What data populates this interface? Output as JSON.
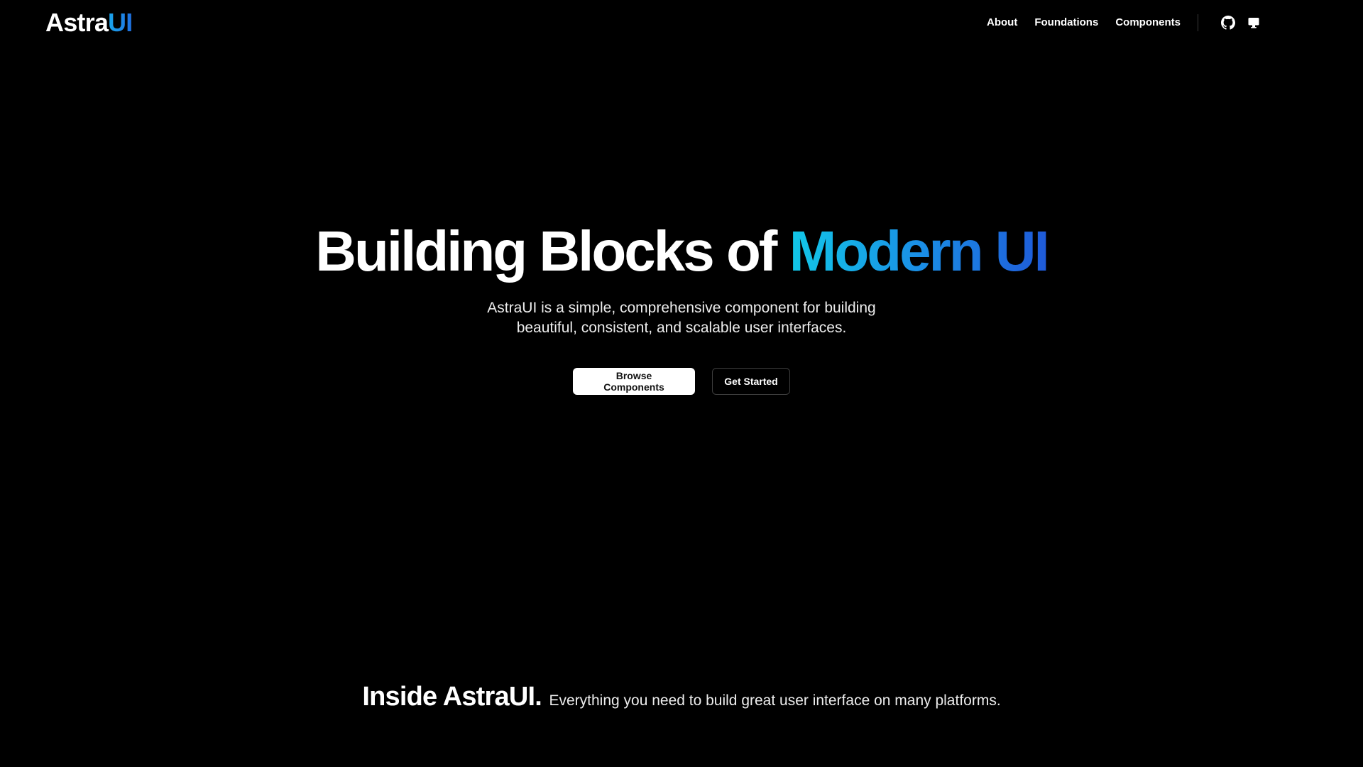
{
  "brand": {
    "name_main": "Astra",
    "name_accent": "UI",
    "accent_gradient": [
      "#1aa7ec",
      "#1f6fe0"
    ]
  },
  "nav": {
    "items": [
      {
        "label": "About"
      },
      {
        "label": "Foundations"
      },
      {
        "label": "Components"
      }
    ],
    "icons": [
      "github-icon",
      "monitor-icon"
    ]
  },
  "hero": {
    "title_plain": "Building Blocks of",
    "title_gradient": "Modern UI",
    "title_gradient_colors": [
      "#12c8e8",
      "#1a8fe6",
      "#1f5ad8"
    ],
    "subtitle_line1": "AstraUI is a simple, comprehensive component for building",
    "subtitle_line2": "beautiful, consistent, and scalable user interfaces.",
    "primary_button": "Browse Components",
    "secondary_button": "Get Started"
  },
  "inside": {
    "title": "Inside AstraUI.",
    "description": "Everything you need to build great user interface on many platforms."
  },
  "colors": {
    "background": "#000000",
    "text": "#ffffff"
  }
}
